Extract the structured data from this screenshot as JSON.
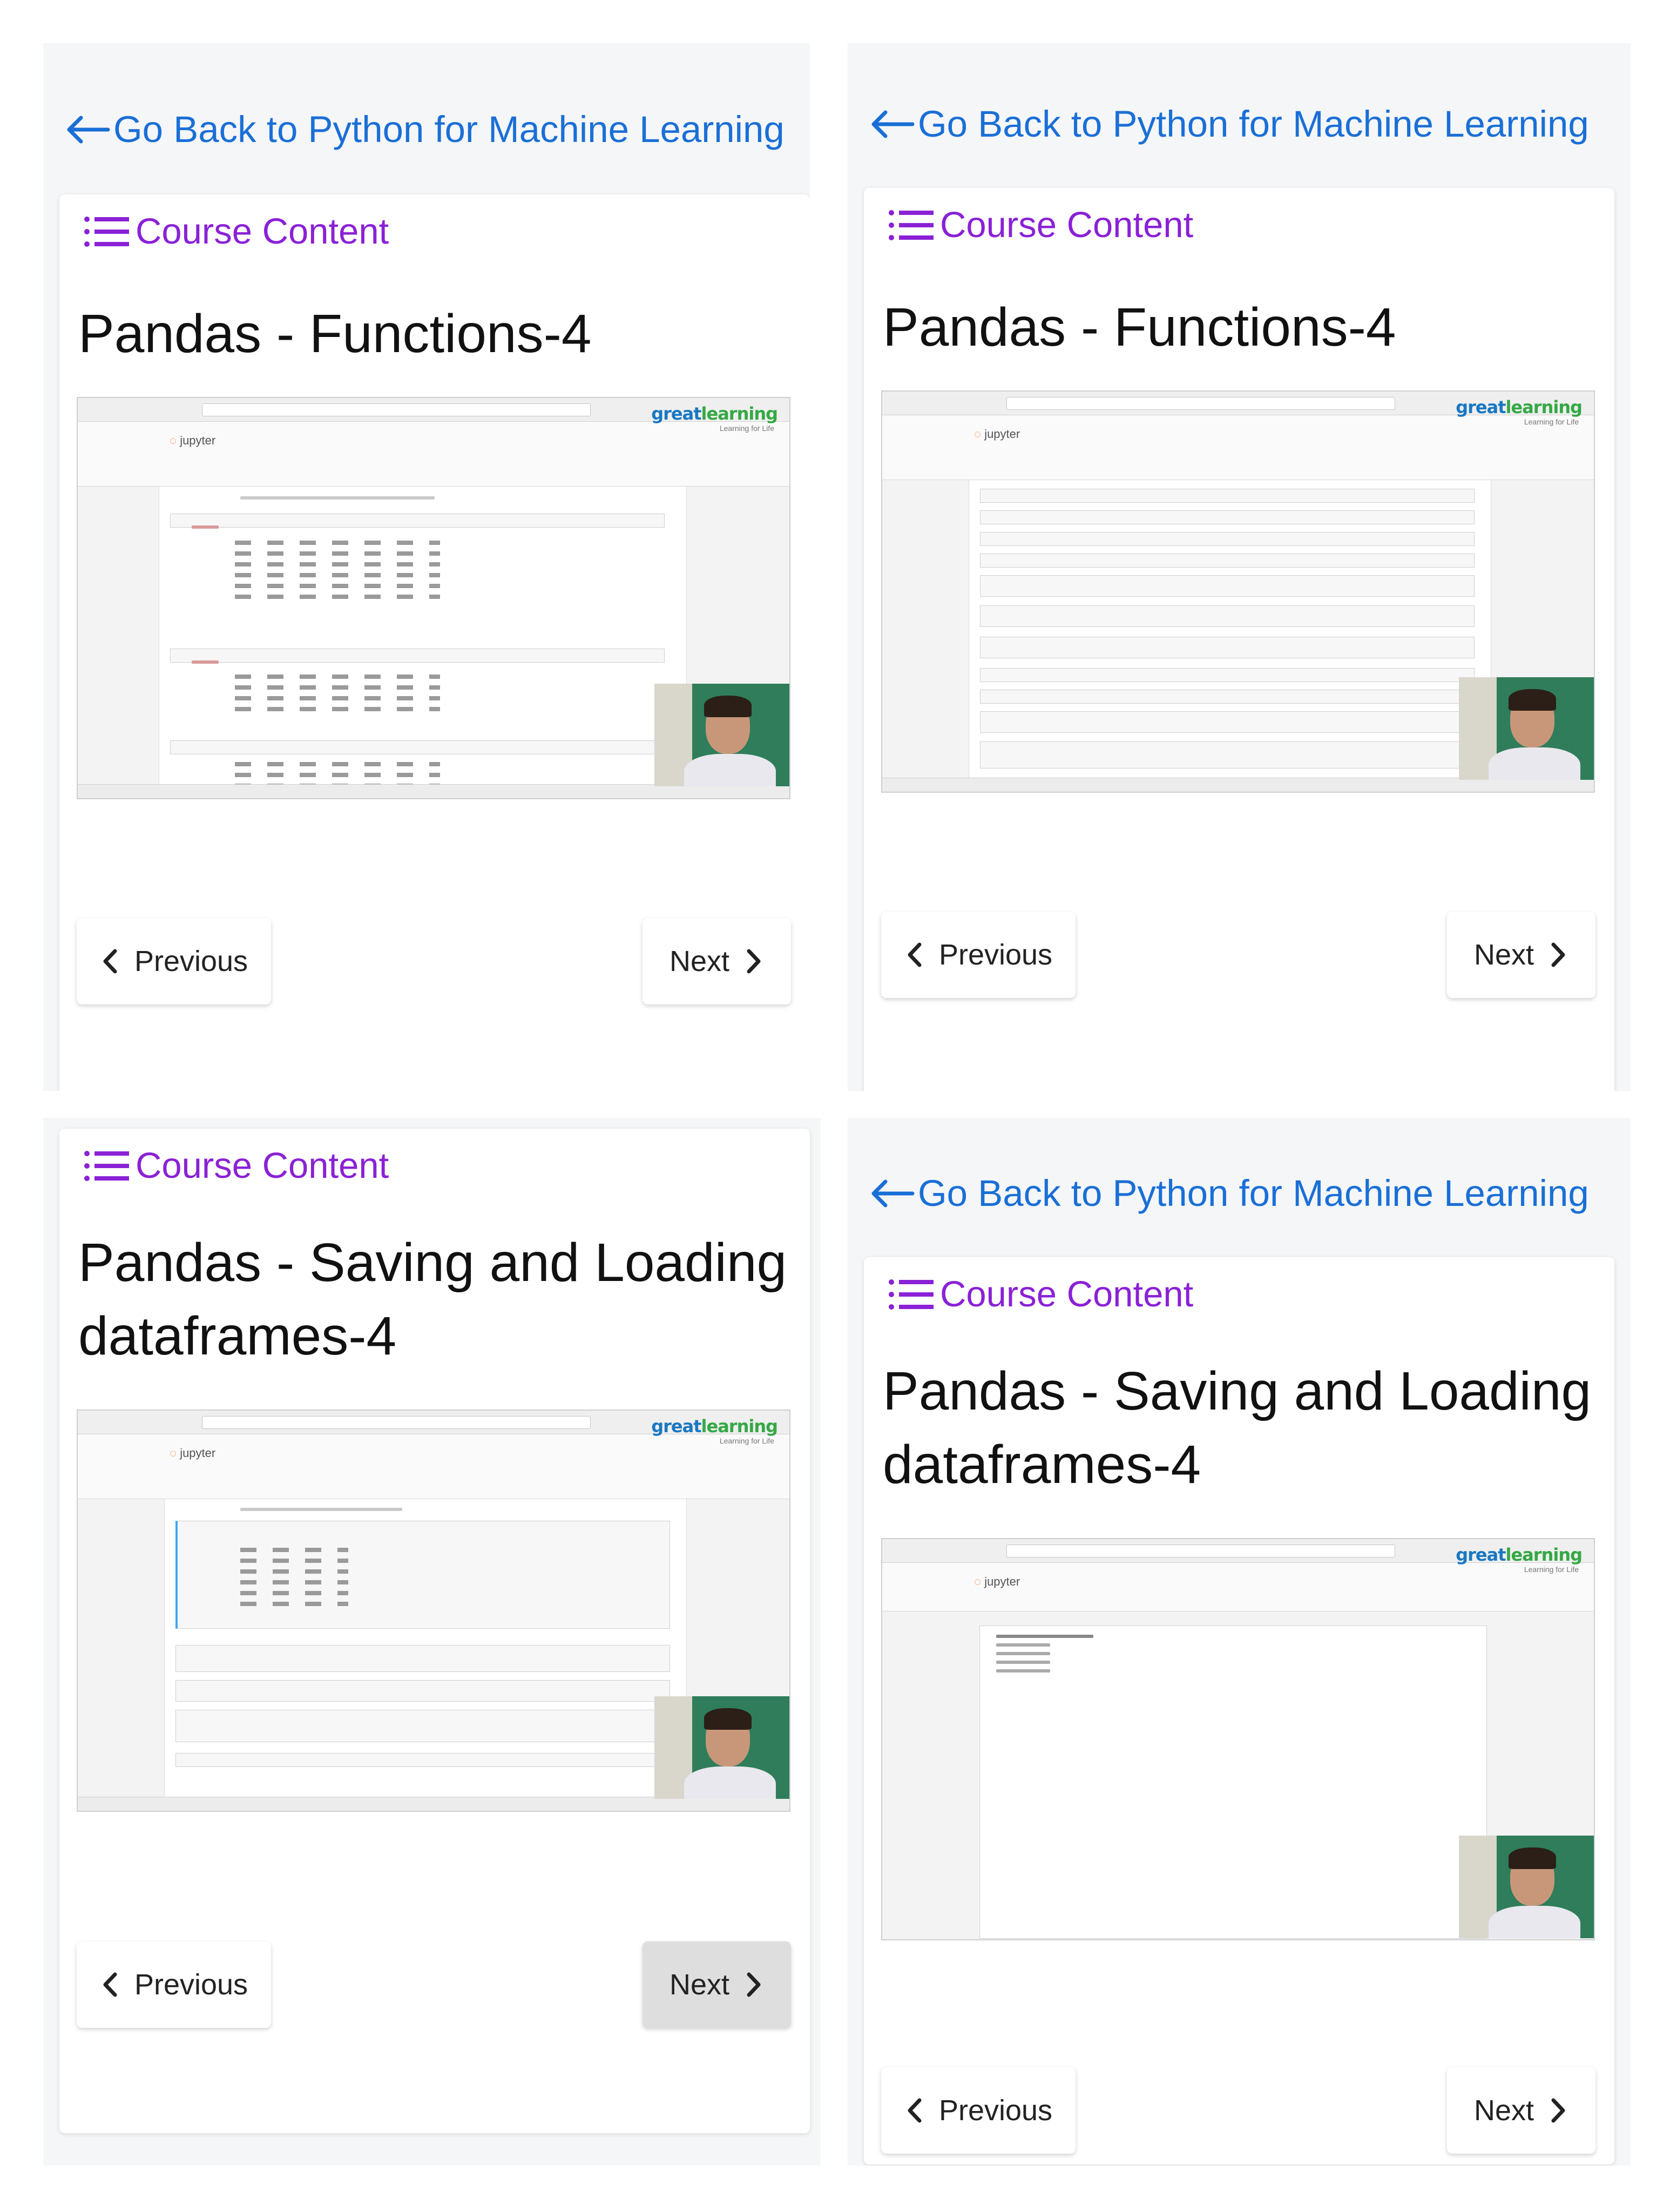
{
  "colors": {
    "link": "#1a6fd6",
    "course_content": "#8a21d6",
    "title": "#111111"
  },
  "panels": [
    {
      "back_link": "Go Back to Python for Machine Learning",
      "course_content": "Course Content",
      "title_lines": [
        "Pandas - Functions-4"
      ],
      "prev": "Previous",
      "next": "Next"
    },
    {
      "back_link": "Go Back to Python for Machine Learning",
      "course_content": "Course Content",
      "title_lines": [
        "Pandas - Functions-4"
      ],
      "prev": "Previous",
      "next": "Next"
    },
    {
      "course_content": "Course Content",
      "title_lines": [
        "Pandas - Saving and Loading",
        "dataframes-4"
      ],
      "prev": "Previous",
      "next": "Next"
    },
    {
      "back_link": "Go Back to Python for Machine Learning",
      "course_content": "Course Content",
      "title_lines": [
        "Pandas - Saving and Loading",
        "dataframes-4"
      ],
      "prev": "Previous",
      "next": "Next"
    }
  ],
  "video": {
    "brand_main": "great",
    "brand_accent": "learning",
    "brand_sub": "Learning for Life",
    "app_name": "jupyter"
  }
}
